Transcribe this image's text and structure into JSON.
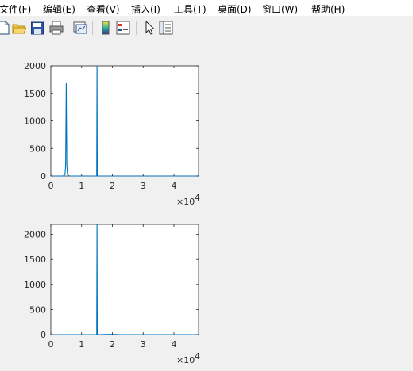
{
  "menubar": {
    "items": [
      {
        "label": "文件(F)"
      },
      {
        "label": "编辑(E)"
      },
      {
        "label": "查看(V)"
      },
      {
        "label": "插入(I)"
      },
      {
        "label": "工具(T)"
      },
      {
        "label": "桌面(D)"
      },
      {
        "label": "窗口(W)"
      },
      {
        "label": "帮助(H)"
      }
    ]
  },
  "toolbar": {
    "icons": [
      "new-figure-icon",
      "open-file-icon",
      "save-icon",
      "print-icon",
      "link-plot-icon",
      "insert-colorbar-icon",
      "insert-legend-icon",
      "edit-plot-pointer-icon",
      "property-inspector-icon"
    ]
  },
  "colors": {
    "line": "#0072bd",
    "axes_background": "#ffffff",
    "figure_background": "#f0f0f0"
  },
  "chart_data": [
    {
      "type": "line",
      "title": "",
      "xlabel": "",
      "ylabel": "",
      "xlim": [
        0,
        48000
      ],
      "ylim": [
        0,
        2000
      ],
      "x_exponent_label": "×10",
      "x_exponent_power": "4",
      "xticks": [
        0,
        10000,
        20000,
        30000,
        40000
      ],
      "xtick_labels": [
        "0",
        "1",
        "2",
        "3",
        "4"
      ],
      "yticks": [
        0,
        500,
        1000,
        1500,
        2000
      ],
      "ytick_labels": [
        "0",
        "500",
        "1000",
        "1500",
        "2000"
      ],
      "grid": false,
      "series": [
        {
          "x": [
            0,
            4000,
            4600,
            4800,
            4900,
            5000,
            5100,
            5200,
            5400,
            6000,
            14900,
            15000,
            15100,
            48000
          ],
          "y": [
            0,
            0,
            30,
            200,
            900,
            1680,
            900,
            200,
            30,
            0,
            0,
            2000,
            0,
            0
          ]
        }
      ]
    },
    {
      "type": "line",
      "title": "",
      "xlabel": "",
      "ylabel": "",
      "xlim": [
        0,
        48000
      ],
      "ylim": [
        0,
        2200
      ],
      "x_exponent_label": "×10",
      "x_exponent_power": "4",
      "xticks": [
        0,
        10000,
        20000,
        30000,
        40000
      ],
      "xtick_labels": [
        "0",
        "1",
        "2",
        "3",
        "4"
      ],
      "yticks": [
        0,
        500,
        1000,
        1500,
        2000
      ],
      "ytick_labels": [
        "0",
        "500",
        "1000",
        "1500",
        "2000"
      ],
      "grid": false,
      "series": [
        {
          "x": [
            0,
            14900,
            15000,
            15100,
            18000,
            20000,
            22000,
            48000
          ],
          "y": [
            0,
            0,
            2200,
            0,
            3,
            5,
            2,
            0
          ]
        }
      ]
    }
  ]
}
